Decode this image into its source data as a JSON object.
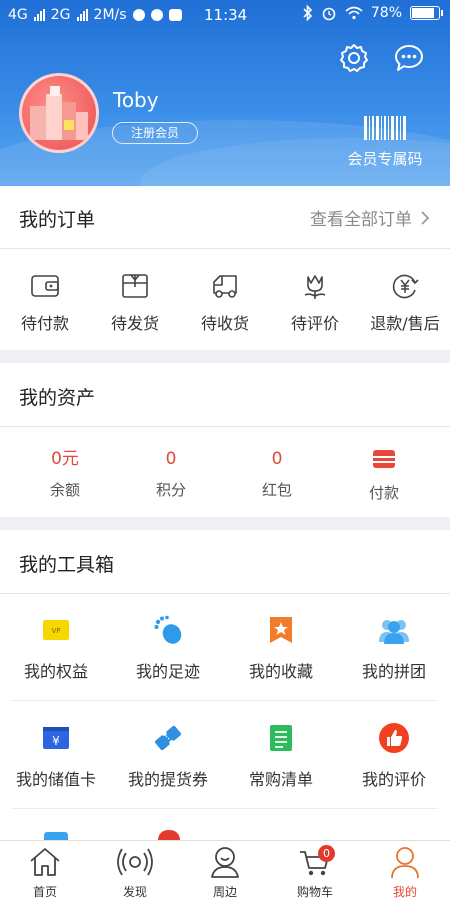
{
  "status_bar": {
    "network_left": "4G",
    "network_right": "2G",
    "speed": "2M/s",
    "time": "11:34",
    "battery": "78%",
    "battery_level": 0.78
  },
  "profile": {
    "username": "Toby",
    "member_badge": "注册会员",
    "member_code_label": "会员专属码",
    "settings_icon": "gear-icon",
    "message_icon": "chat-bubble-icon"
  },
  "orders": {
    "title": "我的订单",
    "view_all": "查看全部订单",
    "items": [
      {
        "label": "待付款",
        "icon": "wallet-icon"
      },
      {
        "label": "待发货",
        "icon": "box-icon"
      },
      {
        "label": "待收货",
        "icon": "truck-icon"
      },
      {
        "label": "待评价",
        "icon": "flower-icon"
      },
      {
        "label": "退款/售后",
        "icon": "refund-icon"
      }
    ]
  },
  "assets": {
    "title": "我的资产",
    "items": [
      {
        "value": "0元",
        "label": "余额"
      },
      {
        "value": "0",
        "label": "积分"
      },
      {
        "value": "0",
        "label": "红包"
      },
      {
        "value": "",
        "label": "付款",
        "icon": "card-icon"
      }
    ]
  },
  "tools": {
    "title": "我的工具箱",
    "items": [
      {
        "label": "我的权益",
        "icon": "vip-card-icon",
        "color": "#f4d800"
      },
      {
        "label": "我的足迹",
        "icon": "footprint-icon",
        "color": "#2f9be8"
      },
      {
        "label": "我的收藏",
        "icon": "star-bookmark-icon",
        "color": "#f37b2a"
      },
      {
        "label": "我的拼团",
        "icon": "group-icon",
        "color": "#3aa3f0"
      },
      {
        "label": "我的储值卡",
        "icon": "yuan-card-icon",
        "color": "#2b66e0"
      },
      {
        "label": "我的提货券",
        "icon": "ticket-icon",
        "color": "#2f8fe0"
      },
      {
        "label": "常购清单",
        "icon": "list-icon",
        "color": "#2dbb5c"
      },
      {
        "label": "我的评价",
        "icon": "thumbs-up-icon",
        "color": "#f0401f"
      }
    ]
  },
  "bottom_nav": {
    "items": [
      {
        "label": "首页",
        "icon": "home-icon"
      },
      {
        "label": "发现",
        "icon": "broadcast-icon"
      },
      {
        "label": "周边",
        "icon": "nearby-person-icon"
      },
      {
        "label": "购物车",
        "icon": "cart-icon",
        "badge": "0"
      },
      {
        "label": "我的",
        "icon": "user-icon",
        "active": true
      }
    ]
  },
  "colors": {
    "header_blue": "#2f80e0",
    "accent_red": "#e2483d",
    "active_orange": "#e24a2e"
  }
}
